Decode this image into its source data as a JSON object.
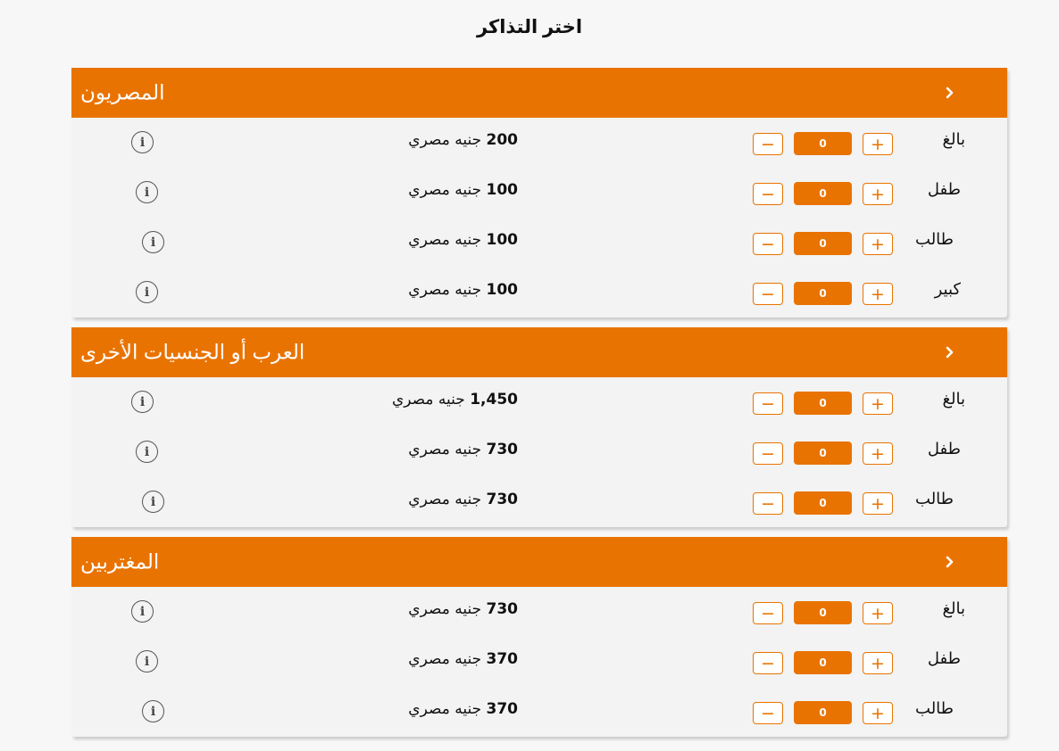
{
  "page_title": "اختر التذاكر",
  "currency": "جنيه مصري",
  "colors": {
    "accent": "#e97300",
    "panel": "#f3f3f3",
    "background": "#f7f7f7"
  },
  "sections": [
    {
      "title": "المصريون",
      "rows": [
        {
          "category": "بالغ",
          "price": "200",
          "quantity": "0"
        },
        {
          "category": "طفل",
          "price": "100",
          "quantity": "0"
        },
        {
          "category": "طالب",
          "price": "100",
          "quantity": "0"
        },
        {
          "category": "كبير",
          "price": "100",
          "quantity": "0"
        }
      ]
    },
    {
      "title": "العرب أو الجنسيات الأخرى",
      "rows": [
        {
          "category": "بالغ",
          "price": "1,450",
          "quantity": "0"
        },
        {
          "category": "طفل",
          "price": "730",
          "quantity": "0"
        },
        {
          "category": "طالب",
          "price": "730",
          "quantity": "0"
        }
      ]
    },
    {
      "title": "المغتربين",
      "rows": [
        {
          "category": "بالغ",
          "price": "730",
          "quantity": "0"
        },
        {
          "category": "طفل",
          "price": "370",
          "quantity": "0"
        },
        {
          "category": "طالب",
          "price": "370",
          "quantity": "0"
        }
      ]
    }
  ],
  "icons": {
    "info": "info-icon",
    "expand": "chevron-right-icon",
    "minus": "minus-icon",
    "plus": "plus-icon"
  },
  "button_labels": {
    "minus": "−",
    "plus": "+"
  },
  "info_glyph": "i"
}
